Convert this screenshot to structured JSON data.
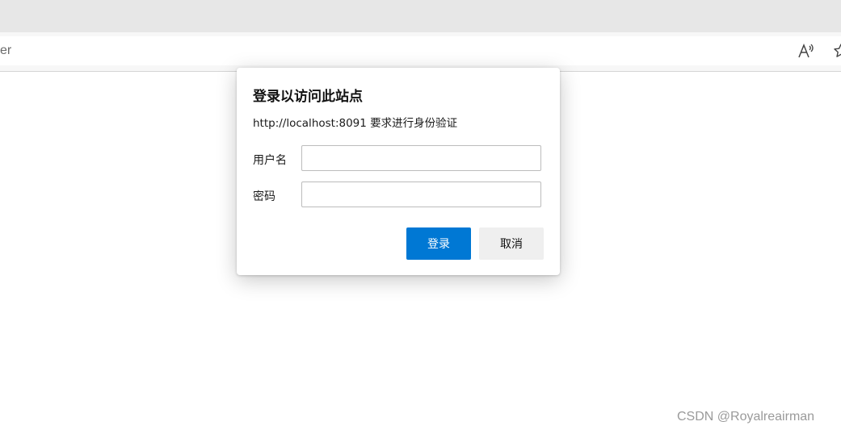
{
  "browser": {
    "address_text": "er",
    "toolbar_icons": [
      "read-aloud-icon",
      "favorites-star-icon"
    ]
  },
  "dialog": {
    "title": "登录以访问此站点",
    "subtitle": "http://localhost:8091 要求进行身份验证",
    "username_label": "用户名",
    "username_value": "",
    "password_label": "密码",
    "password_value": "",
    "login_button": "登录",
    "cancel_button": "取消"
  },
  "colors": {
    "primary_button": "#0078d4",
    "secondary_button": "#efefef",
    "tabstrip": "#e7e7e7"
  },
  "watermark": "CSDN @Royalreairman"
}
